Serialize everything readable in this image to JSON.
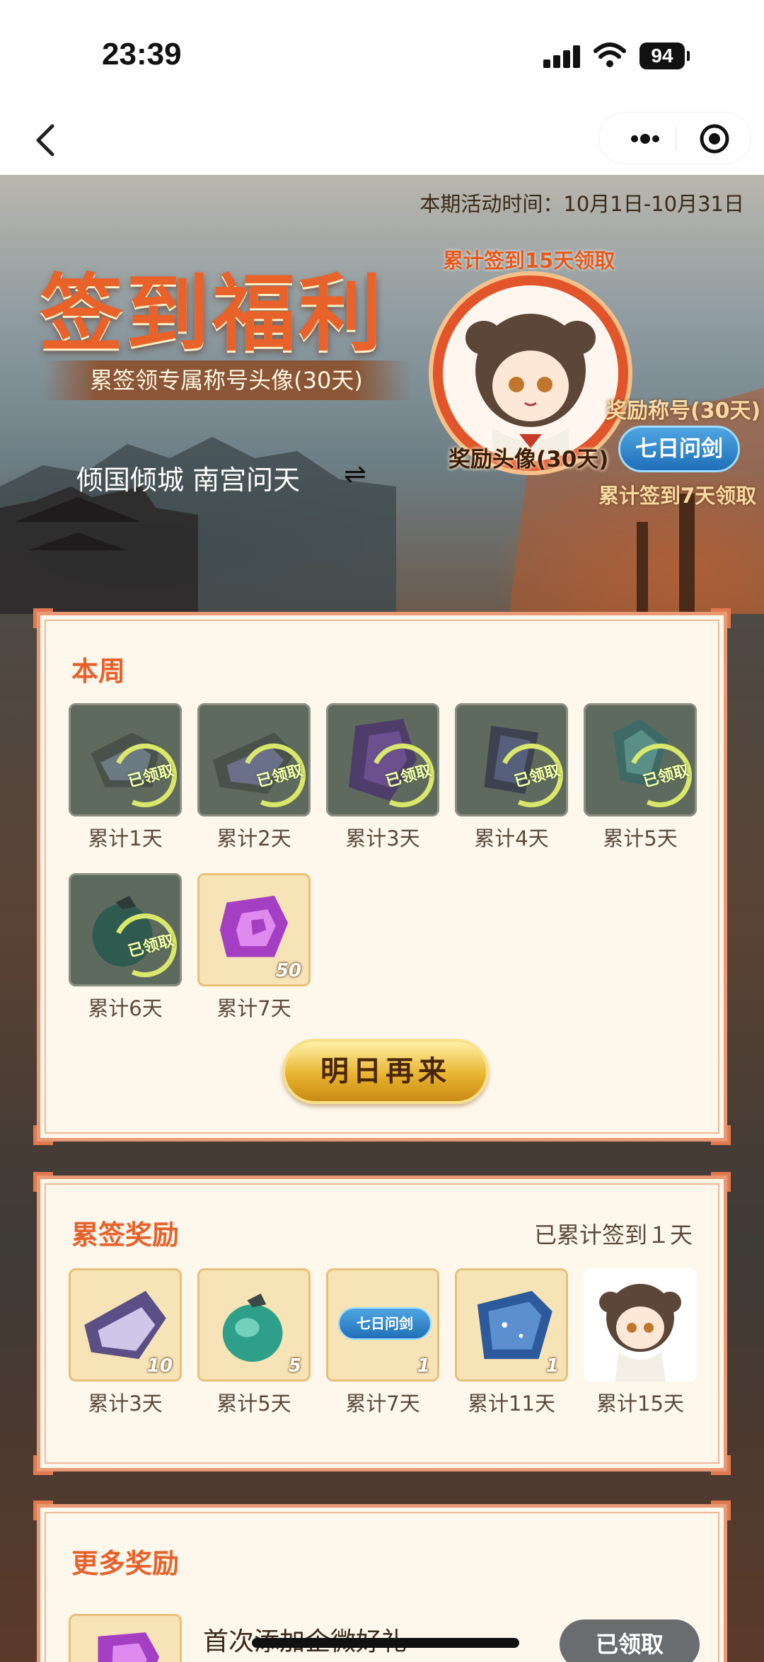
{
  "status_bar": {
    "time": "23:39",
    "battery": "94"
  },
  "nav": {
    "back_icon": "back-icon",
    "more_icon": "more-icon",
    "close_icon": "close-icon"
  },
  "banner": {
    "period": "本期活动时间：10月1日-10月31日",
    "title": "签到福利",
    "subtitle": "累签领专属称号头像(30天)",
    "nickname": "倾国倾城 南宫问天",
    "swap_symbol": "⇌",
    "cumulative_15_text": "累计签到15天领取",
    "reward_avatar_label": "奖励头像(30天)",
    "reward_title_label": "奖励称号(30天)",
    "title_badge": "七日问剑",
    "cumulative_7_text": "累计签到7天领取"
  },
  "week_panel": {
    "title": "本周",
    "items": [
      {
        "label": "累计1天",
        "status": "已领取"
      },
      {
        "label": "累计2天",
        "status": "已领取"
      },
      {
        "label": "累计3天",
        "status": "已领取"
      },
      {
        "label": "累计4天",
        "status": "已领取"
      },
      {
        "label": "累计5天",
        "status": "已领取"
      },
      {
        "label": "累计6天",
        "status": "已领取"
      },
      {
        "label": "累计7天",
        "qty": "50"
      }
    ],
    "button": "明日再来"
  },
  "cumulative_panel": {
    "title": "累签奖励",
    "progress_text": "已累计签到１天",
    "items": [
      {
        "label": "累计3天",
        "qty": "10"
      },
      {
        "label": "累计5天",
        "qty": "5"
      },
      {
        "label": "累计7天",
        "qty": "1",
        "badge": "七日问剑"
      },
      {
        "label": "累计11天",
        "qty": "1"
      },
      {
        "label": "累计15天"
      }
    ]
  },
  "more_panel": {
    "title": "更多奖励",
    "first_item_text": "首次添加企微好礼",
    "claim_button": "已领取"
  },
  "colors": {
    "accent": "#e6622c",
    "panel_bg": "#fdf7ec",
    "panel_border": "#e99a74"
  }
}
